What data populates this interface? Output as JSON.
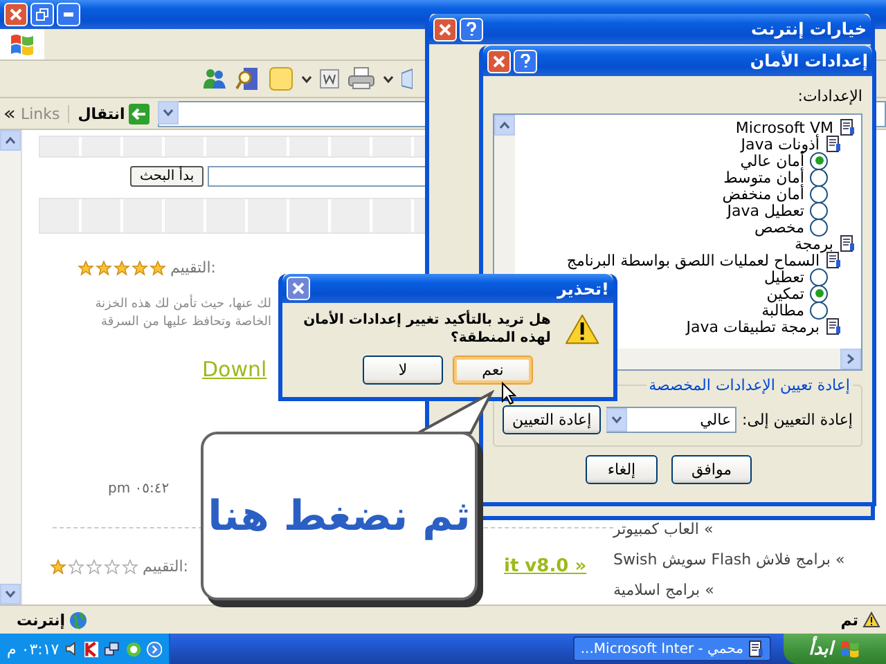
{
  "browser": {
    "address": {
      "links": "Links",
      "go": "انتقال"
    },
    "page": {
      "search_button": "بدأ البحث",
      "posts": [
        {
          "rating_label": "التقييم:",
          "stars": 5,
          "description": [
            "لك عنها، حيث تأمن لك هذه الخزنة",
            "الخاصة وتحافظ عليها من السرقة"
          ],
          "link": "Downl",
          "time": "pm ٠٥:٤٢"
        },
        {
          "rating_label": "التقييم:",
          "stars": 1,
          "link": "it v8.0 »"
        }
      ],
      "sidebar_links": [
        "» العاب كمبيوتر",
        "» برامج فلاش Flash سويش Swish",
        "» برامج اسلامية"
      ]
    },
    "status_bar": {
      "status": "تم",
      "zone": "إنترنت"
    }
  },
  "internet_options": {
    "title": "خيارات إنترنت"
  },
  "security_settings": {
    "title": "إعدادات الأمان",
    "settings_label": "الإعدادات:",
    "tree": [
      {
        "kind": "group",
        "label": "Microsoft VM",
        "children": [
          {
            "kind": "group",
            "label": "أذونات Java",
            "children": [
              {
                "kind": "option",
                "label": "أمان عالي",
                "selected": true
              },
              {
                "kind": "option",
                "label": "أمان متوسط",
                "selected": false
              },
              {
                "kind": "option",
                "label": "أمان منخفض",
                "selected": false
              },
              {
                "kind": "option",
                "label": "تعطيل Java",
                "selected": false
              },
              {
                "kind": "option",
                "label": "مخصص",
                "selected": false
              }
            ]
          }
        ]
      },
      {
        "kind": "group",
        "label": "برمجة",
        "children": [
          {
            "kind": "group",
            "label": "السماح لعمليات اللصق بواسطة البرنامج",
            "children": [
              {
                "kind": "option",
                "label": "تعطيل",
                "selected": false
              },
              {
                "kind": "option",
                "label": "تمكين",
                "selected": true
              },
              {
                "kind": "option",
                "label": "مطالبة",
                "selected": false
              }
            ]
          },
          {
            "kind": "group",
            "label": "برمجة تطبيقات Java"
          }
        ]
      }
    ],
    "reset_group": "إعادة تعيين الإعدادات المخصصة",
    "reset_to_label": "إعادة التعيين إلى:",
    "reset_to_value": "عالي",
    "reset_button": "إعادة التعيين",
    "buttons": [
      "موافق",
      "إلغاء"
    ]
  },
  "warning": {
    "title": "تحذير!",
    "message": "هل تريد بالتأكيد تغيير إعدادات الأمان لهذه المنطقة؟",
    "buttons": [
      {
        "label": "نعم",
        "focused": true
      },
      {
        "label": "لا",
        "focused": false
      }
    ]
  },
  "callout": {
    "text": "ثم نضغط هنا"
  },
  "taskbar": {
    "start": "ابدأ",
    "tasks": [
      {
        "label": "محمي - Microsoft Inter...",
        "selected": false
      }
    ],
    "clock": "٠٣:١٧ م"
  }
}
